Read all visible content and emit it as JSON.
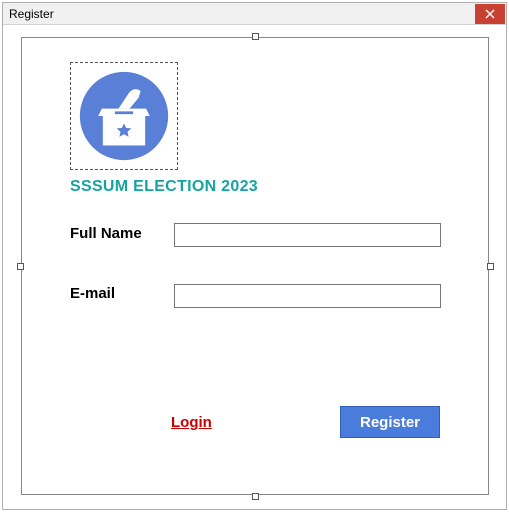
{
  "window": {
    "title": "Register",
    "close_icon": "close"
  },
  "form": {
    "heading": "SSSUM ELECTION 2023",
    "fullname_label": "Full Name",
    "fullname_value": "",
    "email_label": "E-mail",
    "email_value": "",
    "login_link": "Login",
    "register_button": "Register"
  },
  "icons": {
    "logo": "ballot-box"
  },
  "colors": {
    "accent_teal": "#18a3a3",
    "link_red": "#cc0000",
    "button_blue": "#4a7ddb",
    "logo_blue": "#5a7fd6"
  }
}
